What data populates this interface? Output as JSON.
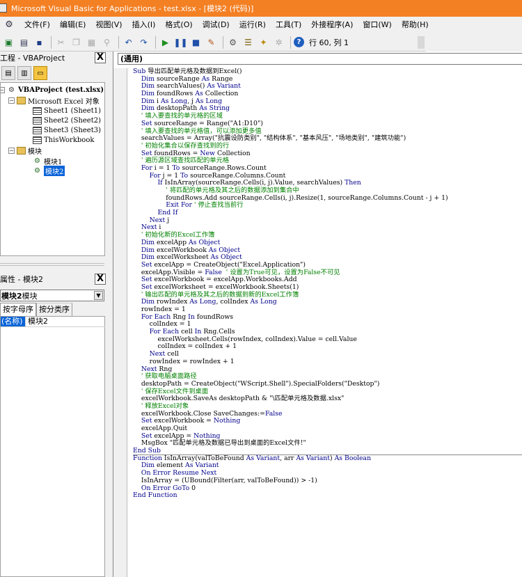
{
  "window": {
    "title": "Microsoft Visual Basic for Applications - test.xlsx - [模块2 (代码)]"
  },
  "menu": [
    "文件(F)",
    "编辑(E)",
    "视图(V)",
    "插入(I)",
    "格式(O)",
    "调试(D)",
    "运行(R)",
    "工具(T)",
    "外接程序(A)",
    "窗口(W)",
    "帮助(H)"
  ],
  "toolbar": {
    "position": "行 60, 列 1"
  },
  "project_panel": {
    "title": "工程 - VBAProject",
    "close": "X",
    "tree": [
      {
        "label": "VBAProject (test.xlsx)",
        "expander": "−",
        "icon": "proj"
      },
      {
        "label": "Microsoft Excel 对象",
        "expander": "−",
        "icon": "folder"
      },
      {
        "label": "Sheet1 (Sheet1)",
        "icon": "sheet"
      },
      {
        "label": "Sheet2 (Sheet2)",
        "icon": "sheet"
      },
      {
        "label": "Sheet3 (Sheet3)",
        "icon": "sheet"
      },
      {
        "label": "ThisWorkbook",
        "icon": "sheet"
      },
      {
        "label": "模块",
        "expander": "−",
        "icon": "folder"
      },
      {
        "label": "模块1",
        "icon": "mod"
      },
      {
        "label": "模块2",
        "icon": "mod",
        "selected": true
      }
    ]
  },
  "properties_panel": {
    "title": "属性 - 模块2",
    "close": "X",
    "combo_bold": "模块2",
    "combo_rest": " 模块",
    "tabs": [
      "按字母序",
      "按分类序"
    ],
    "rows": [
      {
        "name": "(名称)",
        "value": "模块2"
      }
    ]
  },
  "code_window": {
    "object_combo": "(通用)",
    "lines": [
      [
        [
          "kw",
          "Sub "
        ],
        [
          "t",
          "导出匹配单元格及数据到Excel()"
        ]
      ],
      [
        [
          "t",
          "    "
        ],
        [
          "kw",
          "Dim "
        ],
        [
          "t",
          "sourceRange "
        ],
        [
          "kw",
          "As "
        ],
        [
          "t",
          "Range"
        ]
      ],
      [
        [
          "t",
          "    "
        ],
        [
          "kw",
          "Dim "
        ],
        [
          "t",
          "searchValues() "
        ],
        [
          "kw",
          "As Variant"
        ]
      ],
      [
        [
          "t",
          "    "
        ],
        [
          "kw",
          "Dim "
        ],
        [
          "t",
          "foundRows "
        ],
        [
          "kw",
          "As "
        ],
        [
          "t",
          "Collection"
        ]
      ],
      [
        [
          "t",
          "    "
        ],
        [
          "kw",
          "Dim "
        ],
        [
          "t",
          "i "
        ],
        [
          "kw",
          "As Long"
        ],
        [
          "t",
          ", j "
        ],
        [
          "kw",
          "As Long"
        ]
      ],
      [
        [
          "t",
          "    "
        ],
        [
          "kw",
          "Dim "
        ],
        [
          "t",
          "desktopPath "
        ],
        [
          "kw",
          "As String"
        ]
      ],
      [
        [
          "cm",
          "    ' 填入要查找的单元格的区域"
        ]
      ],
      [
        [
          "t",
          "    "
        ],
        [
          "kw",
          "Set "
        ],
        [
          "t",
          "sourceRange = Range(\"A1:D10\")"
        ]
      ],
      [
        [
          "cm",
          "    ' 填入要查找的单元格值，可以添加更多值"
        ]
      ],
      [
        [
          "t",
          "    searchValues = Array(\"抗震设防类别\", \"结构体系\", \"基本风压\", \"场地类别\", \"建筑功能\")"
        ]
      ],
      [
        [
          "cm",
          "    ' 初始化集合以保存查找到的行"
        ]
      ],
      [
        [
          "t",
          "    "
        ],
        [
          "kw",
          "Set "
        ],
        [
          "t",
          "foundRows = "
        ],
        [
          "kw",
          "New "
        ],
        [
          "t",
          "Collection"
        ]
      ],
      [
        [
          "cm",
          "    ' 遍历源区域查找匹配的单元格"
        ]
      ],
      [
        [
          "t",
          "    "
        ],
        [
          "kw",
          "For "
        ],
        [
          "t",
          "i = 1 "
        ],
        [
          "kw",
          "To "
        ],
        [
          "t",
          "sourceRange.Rows.Count"
        ]
      ],
      [
        [
          "t",
          "        "
        ],
        [
          "kw",
          "For "
        ],
        [
          "t",
          "j = 1 "
        ],
        [
          "kw",
          "To "
        ],
        [
          "t",
          "sourceRange.Columns.Count"
        ]
      ],
      [
        [
          "t",
          "            "
        ],
        [
          "kw",
          "If "
        ],
        [
          "t",
          "IsInArray(sourceRange.Cells(i, j).Value, searchValues) "
        ],
        [
          "kw",
          "Then"
        ]
      ],
      [
        [
          "cm",
          "                ' 将匹配的单元格及其之后的数据添加到集合中"
        ]
      ],
      [
        [
          "t",
          "                foundRows.Add sourceRange.Cells(i, j).Resize(1, sourceRange.Columns.Count - j + 1)"
        ]
      ],
      [
        [
          "t",
          "                "
        ],
        [
          "kw",
          "Exit For "
        ],
        [
          "cm",
          "' 停止查找当前行"
        ]
      ],
      [
        [
          "t",
          "            "
        ],
        [
          "kw",
          "End If"
        ]
      ],
      [
        [
          "t",
          "        "
        ],
        [
          "kw",
          "Next "
        ],
        [
          "t",
          "j"
        ]
      ],
      [
        [
          "t",
          "    "
        ],
        [
          "kw",
          "Next "
        ],
        [
          "t",
          "i"
        ]
      ],
      [
        [
          "cm",
          "    ' 初始化新的Excel工作簿"
        ]
      ],
      [
        [
          "t",
          "    "
        ],
        [
          "kw",
          "Dim "
        ],
        [
          "t",
          "excelApp "
        ],
        [
          "kw",
          "As Object"
        ]
      ],
      [
        [
          "t",
          "    "
        ],
        [
          "kw",
          "Dim "
        ],
        [
          "t",
          "excelWorkbook "
        ],
        [
          "kw",
          "As Object"
        ]
      ],
      [
        [
          "t",
          "    "
        ],
        [
          "kw",
          "Dim "
        ],
        [
          "t",
          "excelWorksheet "
        ],
        [
          "kw",
          "As Object"
        ]
      ],
      [
        [
          "t",
          "    "
        ],
        [
          "kw",
          "Set "
        ],
        [
          "t",
          "excelApp = CreateObject(\"Excel.Application\")"
        ]
      ],
      [
        [
          "t",
          "    excelApp.Visible = "
        ],
        [
          "kw",
          "False  "
        ],
        [
          "cm",
          "' 设置为True可见，设置为False不可见"
        ]
      ],
      [
        [
          "t",
          "    "
        ],
        [
          "kw",
          "Set "
        ],
        [
          "t",
          "excelWorkbook = excelApp.Workbooks.Add"
        ]
      ],
      [
        [
          "t",
          "    "
        ],
        [
          "kw",
          "Set "
        ],
        [
          "t",
          "excelWorksheet = excelWorkbook.Sheets(1)"
        ]
      ],
      [
        [
          "cm",
          "    ' 输出匹配的单元格及其之后的数据到新的Excel工作簿"
        ]
      ],
      [
        [
          "t",
          "    "
        ],
        [
          "kw",
          "Dim "
        ],
        [
          "t",
          "rowIndex "
        ],
        [
          "kw",
          "As Long"
        ],
        [
          "t",
          ", colIndex "
        ],
        [
          "kw",
          "As Long"
        ]
      ],
      [
        [
          "t",
          "    rowIndex = 1"
        ]
      ],
      [
        [
          "t",
          "    "
        ],
        [
          "kw",
          "For Each "
        ],
        [
          "t",
          "Rng "
        ],
        [
          "kw",
          "In "
        ],
        [
          "t",
          "foundRows"
        ]
      ],
      [
        [
          "t",
          "        colIndex = 1"
        ]
      ],
      [
        [
          "t",
          "        "
        ],
        [
          "kw",
          "For Each "
        ],
        [
          "t",
          "cell "
        ],
        [
          "kw",
          "In "
        ],
        [
          "t",
          "Rng.Cells"
        ]
      ],
      [
        [
          "t",
          "            excelWorksheet.Cells(rowIndex, colIndex).Value = cell.Value"
        ]
      ],
      [
        [
          "t",
          "            colIndex = colIndex + 1"
        ]
      ],
      [
        [
          "t",
          "        "
        ],
        [
          "kw",
          "Next "
        ],
        [
          "t",
          "cell"
        ]
      ],
      [
        [
          "t",
          "        rowIndex = rowIndex + 1"
        ]
      ],
      [
        [
          "t",
          "    "
        ],
        [
          "kw",
          "Next "
        ],
        [
          "t",
          "Rng"
        ]
      ],
      [
        [
          "cm",
          "    ' 获取电脑桌面路径"
        ]
      ],
      [
        [
          "t",
          "    desktopPath = CreateObject(\"WScript.Shell\").SpecialFolders(\"Desktop\")"
        ]
      ],
      [
        [
          "cm",
          "    ' 保存Excel文件到桌面"
        ]
      ],
      [
        [
          "t",
          "    excelWorkbook.SaveAs desktopPath & \"\\匹配单元格及数据.xlsx\""
        ]
      ],
      [
        [
          "cm",
          "    ' 释放Excel对象"
        ]
      ],
      [
        [
          "t",
          "    excelWorkbook.Close SaveChanges:="
        ],
        [
          "kw",
          "False"
        ]
      ],
      [
        [
          "t",
          "    "
        ],
        [
          "kw",
          "Set "
        ],
        [
          "t",
          "excelWorkbook = "
        ],
        [
          "kw",
          "Nothing"
        ]
      ],
      [
        [
          "t",
          "    excelApp.Quit"
        ]
      ],
      [
        [
          "t",
          "    "
        ],
        [
          "kw",
          "Set "
        ],
        [
          "t",
          "excelApp = "
        ],
        [
          "kw",
          "Nothing"
        ]
      ],
      [
        [
          "t",
          "    MsgBox \"匹配单元格及数据已导出到桌面的Excel文件!\""
        ]
      ],
      [
        [
          "kw",
          "End Sub"
        ]
      ],
      [
        [
          "kw",
          "Function "
        ],
        [
          "t",
          "IsInArray(valToBeFound "
        ],
        [
          "kw",
          "As Variant"
        ],
        [
          "t",
          ", arr "
        ],
        [
          "kw",
          "As Variant"
        ],
        [
          "t",
          ") "
        ],
        [
          "kw",
          "As Boolean"
        ]
      ],
      [
        [
          "t",
          "    "
        ],
        [
          "kw",
          "Dim "
        ],
        [
          "t",
          "element "
        ],
        [
          "kw",
          "As Variant"
        ]
      ],
      [
        [
          "t",
          "    "
        ],
        [
          "kw",
          "On Error Resume Next"
        ]
      ],
      [
        [
          "t",
          "    IsInArray = (UBound(Filter(arr, valToBeFound)) > -1)"
        ]
      ],
      [
        [
          "t",
          "    "
        ],
        [
          "kw",
          "On Error GoTo "
        ],
        [
          "t",
          "0"
        ]
      ],
      [
        [
          "kw",
          "End Function"
        ]
      ]
    ],
    "divider_after": 51
  }
}
